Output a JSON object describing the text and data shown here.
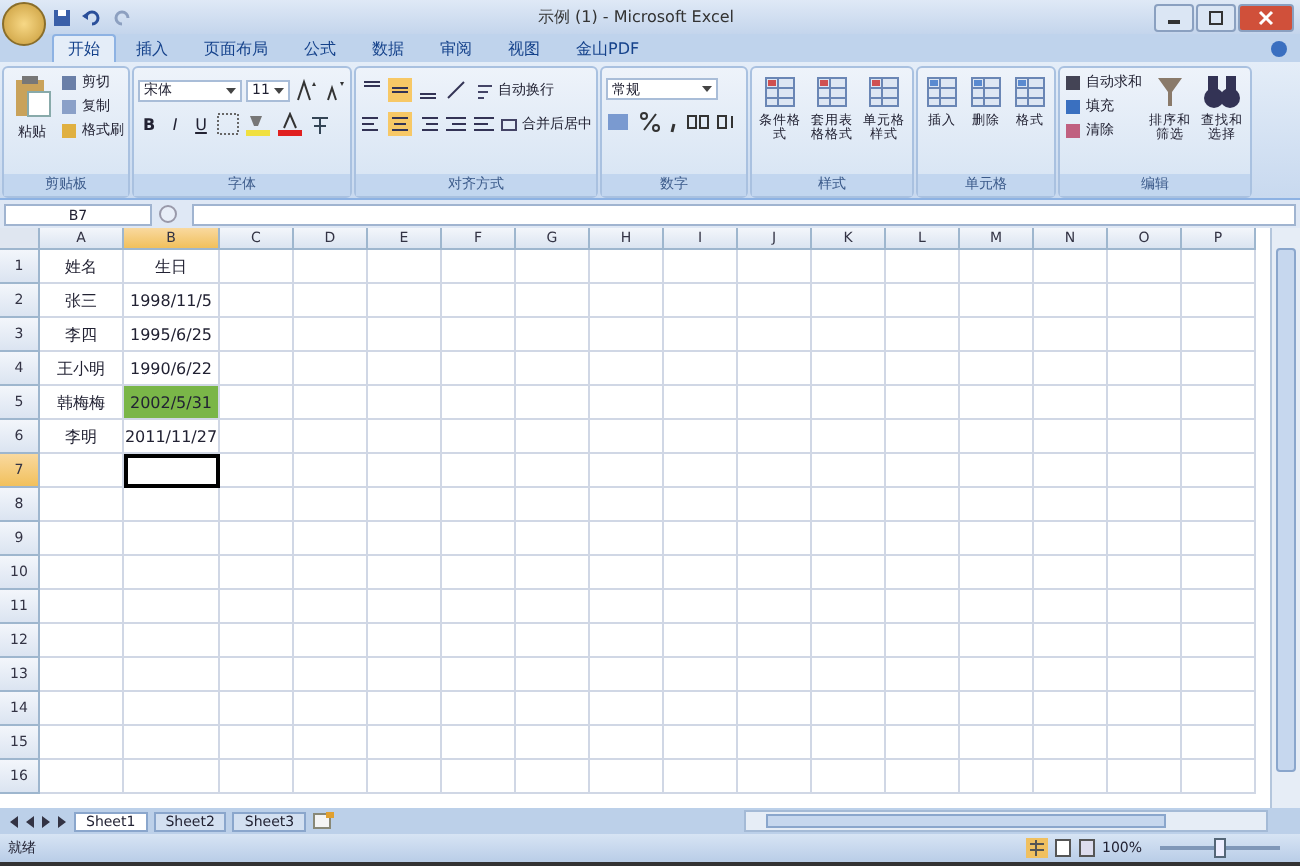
{
  "window": {
    "title": "示例 (1) - Microsoft Excel"
  },
  "tabs": [
    {
      "label": "开始",
      "selected": true
    },
    {
      "label": "插入",
      "selected": false
    },
    {
      "label": "页面布局",
      "selected": false
    },
    {
      "label": "公式",
      "selected": false
    },
    {
      "label": "数据",
      "selected": false
    },
    {
      "label": "审阅",
      "selected": false
    },
    {
      "label": "视图",
      "selected": false
    },
    {
      "label": "金山PDF",
      "selected": false
    }
  ],
  "ribbon": {
    "groups": [
      {
        "kind": "clipboard",
        "label": "剪贴板",
        "big": "粘贴",
        "items": [
          "剪切",
          "复制",
          "格式刷"
        ]
      },
      {
        "kind": "font",
        "label": "字体",
        "font": "宋体",
        "size": "11",
        "format_buttons": [
          "B",
          "I",
          "U"
        ]
      },
      {
        "kind": "alignment",
        "label": "对齐方式",
        "items": [
          "自动换行",
          "合并后居中"
        ]
      },
      {
        "kind": "number",
        "label": "数字",
        "format": "常规"
      },
      {
        "kind": "big_buttons",
        "label": "样式",
        "items": [
          "条件格式",
          "套用表格格式",
          "单元格样式"
        ]
      },
      {
        "kind": "big_buttons",
        "label": "单元格",
        "items": [
          "插入",
          "删除",
          "格式"
        ]
      },
      {
        "kind": "editing",
        "label": "编辑",
        "items": [
          "自动求和",
          "填充",
          "清除"
        ],
        "big": [
          "排序和筛选",
          "查找和选择"
        ]
      }
    ]
  },
  "formula_bar": {
    "name_box": "B7"
  },
  "grid": {
    "columns": [
      {
        "label": "A",
        "selected": false
      },
      {
        "label": "B",
        "selected": true
      },
      {
        "label": "C",
        "selected": false
      },
      {
        "label": "D",
        "selected": false
      },
      {
        "label": "E",
        "selected": false
      },
      {
        "label": "F",
        "selected": false
      },
      {
        "label": "G",
        "selected": false
      },
      {
        "label": "H",
        "selected": false
      },
      {
        "label": "I",
        "selected": false
      },
      {
        "label": "J",
        "selected": false
      },
      {
        "label": "K",
        "selected": false
      },
      {
        "label": "L",
        "selected": false
      },
      {
        "label": "M",
        "selected": false
      },
      {
        "label": "N",
        "selected": false
      },
      {
        "label": "O",
        "selected": false
      },
      {
        "label": "P",
        "selected": false
      }
    ],
    "rows": [
      {
        "label": "1",
        "selected": false,
        "cells": [
          {
            "text": "姓名",
            "highlighted": false
          },
          {
            "text": "生日",
            "highlighted": false
          }
        ]
      },
      {
        "label": "2",
        "selected": false,
        "cells": [
          {
            "text": "张三",
            "highlighted": false
          },
          {
            "text": "1998/11/5",
            "highlighted": false
          }
        ]
      },
      {
        "label": "3",
        "selected": false,
        "cells": [
          {
            "text": "李四",
            "highlighted": false
          },
          {
            "text": "1995/6/25",
            "highlighted": false
          }
        ]
      },
      {
        "label": "4",
        "selected": false,
        "cells": [
          {
            "text": "王小明",
            "highlighted": false
          },
          {
            "text": "1990/6/22",
            "highlighted": false
          }
        ]
      },
      {
        "label": "5",
        "selected": false,
        "cells": [
          {
            "text": "韩梅梅",
            "highlighted": false
          },
          {
            "text": "2002/5/31",
            "highlighted": true
          }
        ]
      },
      {
        "label": "6",
        "selected": false,
        "cells": [
          {
            "text": "李明",
            "highlighted": false
          },
          {
            "text": "2011/11/27",
            "highlighted": false
          }
        ]
      },
      {
        "label": "7",
        "selected": true,
        "cells": []
      },
      {
        "label": "8",
        "selected": false,
        "cells": []
      },
      {
        "label": "9",
        "selected": false,
        "cells": []
      },
      {
        "label": "10",
        "selected": false,
        "cells": []
      },
      {
        "label": "11",
        "selected": false,
        "cells": []
      },
      {
        "label": "12",
        "selected": false,
        "cells": []
      },
      {
        "label": "13",
        "selected": false,
        "cells": []
      },
      {
        "label": "14",
        "selected": false,
        "cells": []
      },
      {
        "label": "15",
        "selected": false,
        "cells": []
      },
      {
        "label": "16",
        "selected": false,
        "cells": []
      }
    ]
  },
  "sheet_tabs": [
    {
      "label": "Sheet1",
      "selected": true
    },
    {
      "label": "Sheet2",
      "selected": false
    },
    {
      "label": "Sheet3",
      "selected": false
    }
  ],
  "status_bar": {
    "status": "就绪",
    "zoom": "100%",
    "level": 0.5
  }
}
